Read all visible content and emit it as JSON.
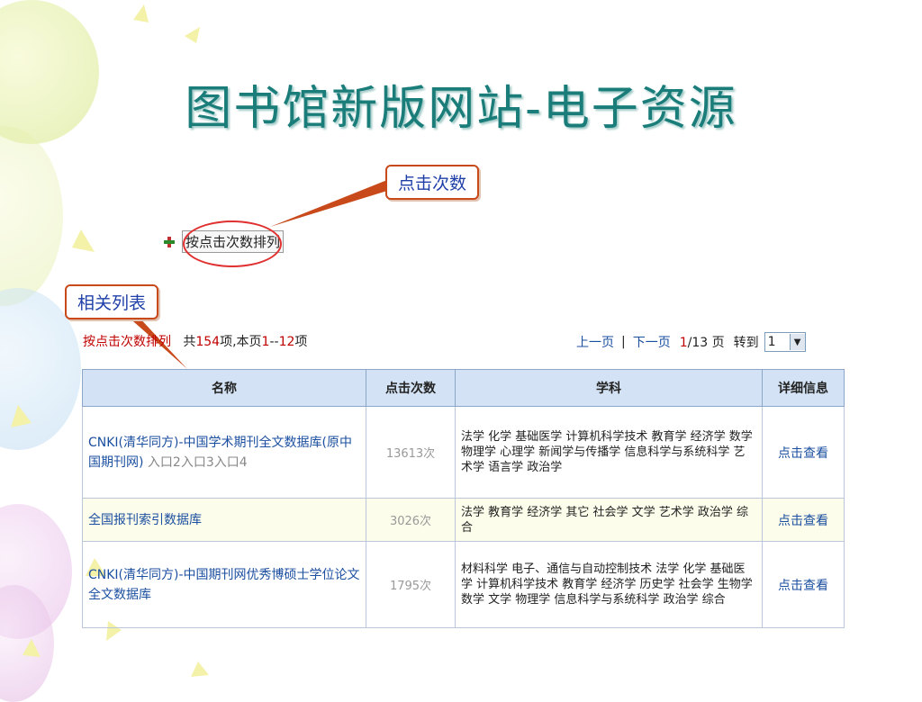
{
  "slide": {
    "title": "图书馆新版网站-电子资源"
  },
  "callouts": {
    "clicks": "点击次数",
    "list": "相关列表"
  },
  "sort_link": "按点击次数排列",
  "summary": {
    "sort_label": "按点击次数排列",
    "total_prefix": "共",
    "total": "154",
    "total_suffix": "项,本页",
    "range_start": "1",
    "range_sep": "--",
    "range_end": "12",
    "range_suffix": "项"
  },
  "pager": {
    "prev": "上一页",
    "sep": "|",
    "next": "下一页",
    "current": "1",
    "total_pages": "/13 页",
    "goto": "转到",
    "select_value": "1"
  },
  "table": {
    "headers": [
      "名称",
      "点击次数",
      "学科",
      "详细信息"
    ],
    "rows": [
      {
        "name": "CNKI(清华同方)-中国学术期刊全文数据库(原中国期刊网)",
        "entries": "入口2入口3入口4",
        "clicks": "13613次",
        "subjects": "法学 化学 基础医学 计算机科学技术 教育学 经济学 数学 物理学 心理学 新闻学与传播学 信息科学与系统科学 艺术学 语言学 政治学",
        "detail": "点击查看"
      },
      {
        "name": "全国报刊索引数据库",
        "entries": "",
        "clicks": "3026次",
        "subjects": "法学 教育学 经济学 其它 社会学 文学 艺术学 政治学 综合",
        "detail": "点击查看"
      },
      {
        "name": "CNKI(清华同方)-中国期刊网优秀博硕士学位论文全文数据库",
        "entries": "",
        "clicks": "1795次",
        "subjects": "材料科学 电子、通信与自动控制技术 法学 化学 基础医学 计算机科学技术 教育学 经济学 历史学 社会学 生物学 数学 文学 物理学 信息科学与系统科学 政治学 综合",
        "detail": "点击查看"
      }
    ]
  },
  "colors": {
    "title": "#1a7d7a",
    "callout_border": "#c84a1a",
    "link": "#1b4fa0",
    "highlight": "#c00000",
    "header_bg": "#d3e3f5",
    "ellipse": "#e03030"
  }
}
